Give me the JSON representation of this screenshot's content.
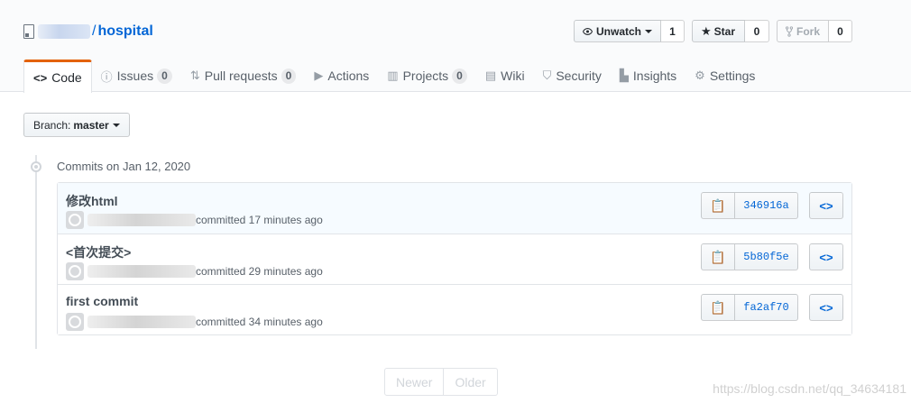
{
  "repo": {
    "owner": "",
    "separator": "/",
    "name": "hospital"
  },
  "actions": {
    "watch": {
      "label": "Unwatch",
      "count": "1"
    },
    "star": {
      "label": "Star",
      "count": "0"
    },
    "fork": {
      "label": "Fork",
      "count": "0"
    }
  },
  "tabs": [
    {
      "label": "Code",
      "icon": "code-icon"
    },
    {
      "label": "Issues",
      "count": "0",
      "icon": "issue-icon"
    },
    {
      "label": "Pull requests",
      "count": "0",
      "icon": "pull-request-icon"
    },
    {
      "label": "Actions",
      "icon": "play-icon"
    },
    {
      "label": "Projects",
      "count": "0",
      "icon": "project-icon"
    },
    {
      "label": "Wiki",
      "icon": "book-icon"
    },
    {
      "label": "Security",
      "icon": "shield-icon"
    },
    {
      "label": "Insights",
      "icon": "graph-icon"
    },
    {
      "label": "Settings",
      "icon": "gear-icon"
    }
  ],
  "branch": {
    "prefix": "Branch:",
    "name": "master"
  },
  "commits_heading": "Commits on Jan 12, 2020",
  "commits": [
    {
      "message": "修改html",
      "meta": "committed 17 minutes ago",
      "sha": "346916a"
    },
    {
      "message": "<首次提交>",
      "meta": "committed 29 minutes ago",
      "sha": "5b80f5e"
    },
    {
      "message": "first commit",
      "meta": "committed 34 minutes ago",
      "sha": "fa2af70"
    }
  ],
  "pagination": {
    "newer": "Newer",
    "older": "Older"
  },
  "watermark": "https://blog.csdn.net/qq_34634181",
  "colors": {
    "link": "#0366d6",
    "tab_accent": "#e36209",
    "header_bg": "#fafbfc"
  }
}
